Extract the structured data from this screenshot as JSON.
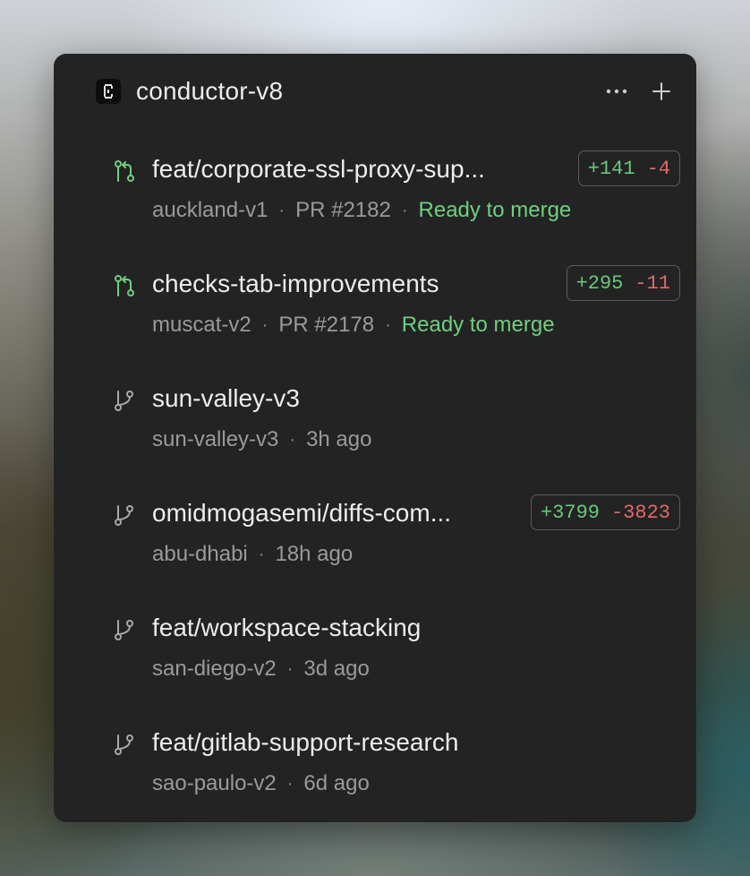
{
  "window": {
    "title": "conductor-v8",
    "more_icon": "more-horizontal-icon",
    "add_icon": "plus-icon",
    "logo_icon": "conductor-logo-icon"
  },
  "colors": {
    "panel_bg": "#232323",
    "text_primary": "#ececec",
    "text_secondary": "#9a9a9a",
    "ready_green": "#6fcf7f",
    "additions_green": "#69c87c",
    "deletions_red": "#e26a6a"
  },
  "workspaces": [
    {
      "icon": "pull-request-icon",
      "title": "feat/corporate-ssl-proxy-sup...",
      "meta": "auckland-v1",
      "pr": "PR #2182",
      "status": "Ready to merge",
      "additions": "+141",
      "deletions": "-4"
    },
    {
      "icon": "pull-request-icon",
      "title": "checks-tab-improvements",
      "meta": "muscat-v2",
      "pr": "PR #2178",
      "status": "Ready to merge",
      "additions": "+295",
      "deletions": "-11"
    },
    {
      "icon": "branch-icon",
      "title": "sun-valley-v3",
      "meta": "sun-valley-v3",
      "time": "3h ago"
    },
    {
      "icon": "branch-icon",
      "title": "omidmogasemi/diffs-com...",
      "meta": "abu-dhabi",
      "time": "18h ago",
      "additions": "+3799",
      "deletions": "-3823"
    },
    {
      "icon": "branch-icon",
      "title": "feat/workspace-stacking",
      "meta": "san-diego-v2",
      "time": "3d ago"
    },
    {
      "icon": "branch-icon",
      "title": "feat/gitlab-support-research",
      "meta": "sao-paulo-v2",
      "time": "6d ago"
    }
  ]
}
